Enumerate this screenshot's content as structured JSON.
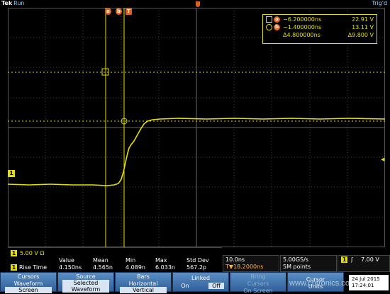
{
  "header": {
    "brand": "Tek",
    "status": "Run",
    "trigger_status": "Trig'd"
  },
  "colors": {
    "trace": "#e6e000",
    "grid": "#5a5a5a",
    "cursor_badge": "#e06020",
    "menu": "#3a6ea8"
  },
  "markers": {
    "ch1": "1",
    "cursor_a": "a",
    "cursor_b": "b",
    "trigger": "T"
  },
  "cursor_readout": {
    "a_time": "−6.200000ns",
    "a_volt": "22.91 V",
    "b_time": "−1.400000ns",
    "b_volt": "13.11 V",
    "delta_time": "Δ4.800000ns",
    "delta_volt": "Δ9.800 V"
  },
  "channel": {
    "number": "1",
    "scale": "5.00 V",
    "coupling": "Ω"
  },
  "measurement": {
    "headers": [
      "Value",
      "Mean",
      "Min",
      "Max",
      "Std Dev"
    ],
    "row_label": "Rise Time",
    "values": [
      "4.150ns",
      "4.565n",
      "4.089n",
      "6.033n",
      "567.2p"
    ]
  },
  "horizontal": {
    "scale": "10.0ns",
    "position": "T▼18.2000ns"
  },
  "acquisition": {
    "rate": "5.00GS/s",
    "points": "5M points"
  },
  "trigger": {
    "source": "1",
    "slope": "ʃ",
    "level": "7.00 V"
  },
  "datetime": {
    "date": "24 Jul 2015",
    "time": "17:24:01"
  },
  "menu": [
    {
      "line1": "Cursors",
      "line2": "Waveform",
      "line3": "Screen"
    },
    {
      "line1": "Source",
      "line2": "Selected",
      "line3": "Waveform"
    },
    {
      "line1": "Bars",
      "line2": "Horizontal",
      "line3": "Vertical"
    },
    {
      "line1": "Linked",
      "on": "On",
      "off": "Off"
    },
    {
      "line1": "Bring",
      "line2": "Cursors",
      "line3": "On Screen"
    },
    {
      "line1": "Cursor",
      "line2": "Units"
    }
  ],
  "watermark": "www.cntronics.com"
}
